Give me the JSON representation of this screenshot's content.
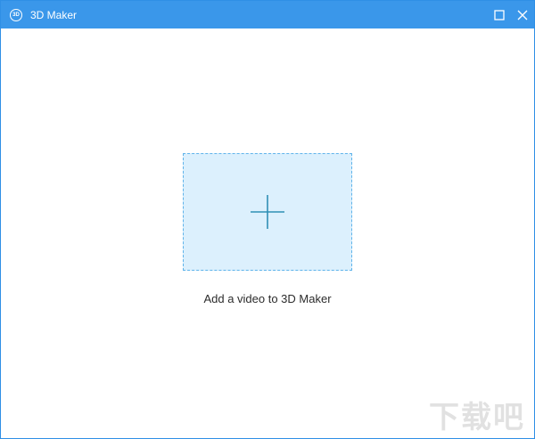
{
  "window": {
    "title": "3D Maker",
    "icon_label": "3D",
    "icon": "app-3d-icon",
    "controls": {
      "maximize_icon": "maximize-icon",
      "close_icon": "close-icon"
    }
  },
  "main": {
    "dropzone_icon": "plus-icon",
    "prompt": "Add a video to 3D Maker"
  },
  "watermark": {
    "text": "下载吧"
  },
  "colors": {
    "titlebar": "#3a97ea",
    "dropzone_fill": "#dcf0fd",
    "dropzone_border": "#5fb3ea",
    "plus": "#2f8fb5"
  }
}
